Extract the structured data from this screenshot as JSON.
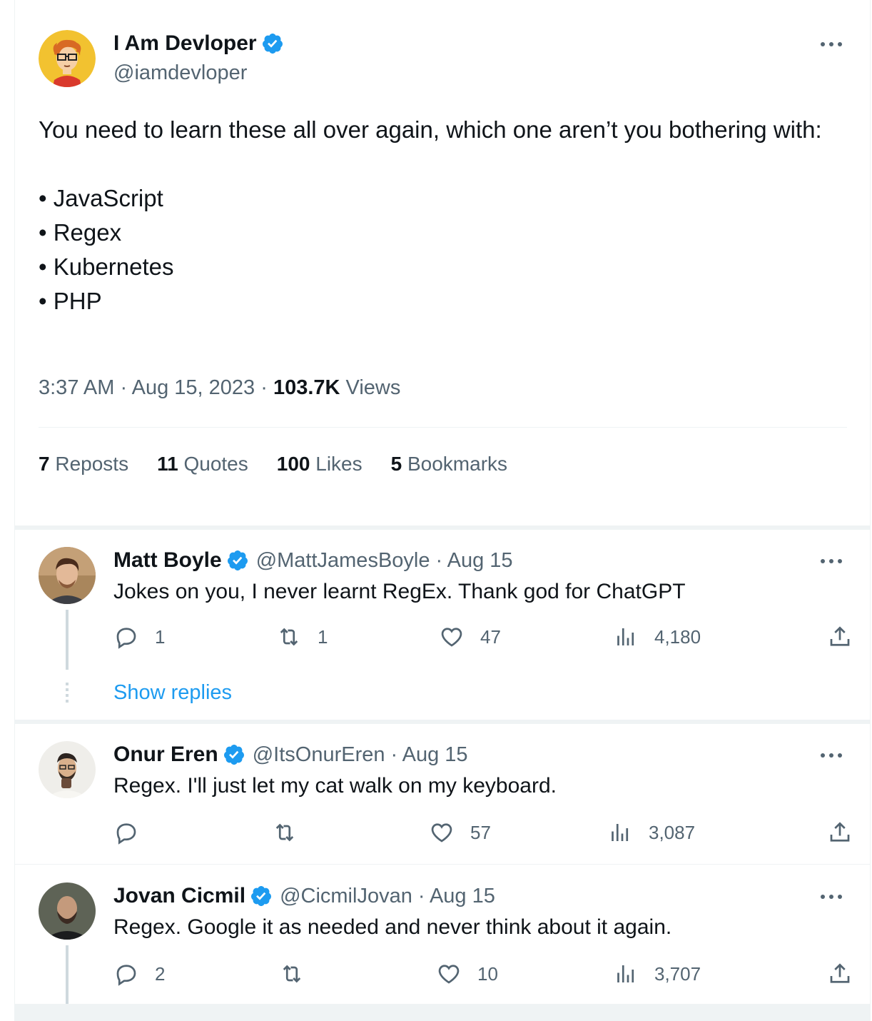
{
  "main_tweet": {
    "author": {
      "name": "I Am Devloper",
      "handle": "@iamdevloper",
      "avatar_icon": "cartoon-developer-avatar",
      "verified": true
    },
    "text_intro": "You need to learn these all over again, which one aren’t you bothering with:",
    "bullets": [
      "• JavaScript",
      "• Regex",
      "• Kubernetes",
      "• PHP"
    ],
    "time": "3:37 AM",
    "date": "Aug 15, 2023",
    "dot": "·",
    "views_count": "103.7K",
    "views_label": "Views",
    "stats": [
      {
        "count": "7",
        "label": "Reposts"
      },
      {
        "count": "11",
        "label": "Quotes"
      },
      {
        "count": "100",
        "label": "Likes"
      },
      {
        "count": "5",
        "label": "Bookmarks"
      }
    ]
  },
  "replies": [
    {
      "name": "Matt Boyle",
      "handle": "@MattJamesBoyle",
      "date_text": "· Aug 15",
      "text": "Jokes on you, I never learnt RegEx. Thank god for ChatGPT",
      "replies": "1",
      "reposts": "1",
      "likes": "47",
      "views": "4,180"
    },
    {
      "name": "Onur Eren",
      "handle": "@ItsOnurEren",
      "date_text": "· Aug 15",
      "text": "Regex. I'll just let my cat walk on my keyboard.",
      "replies": "",
      "reposts": "",
      "likes": "57",
      "views": "3,087"
    },
    {
      "name": "Jovan Cicmil",
      "handle": "@CicmilJovan",
      "date_text": "· Aug 15",
      "text": "Regex. Google it as needed and never think about it again.",
      "replies": "2",
      "reposts": "",
      "likes": "10",
      "views": "3,707"
    }
  ],
  "show_replies_label": "Show replies",
  "colors": {
    "accent": "#1d9bf0",
    "text": "#0f1419",
    "muted": "#536471",
    "border": "#eff3f4"
  }
}
